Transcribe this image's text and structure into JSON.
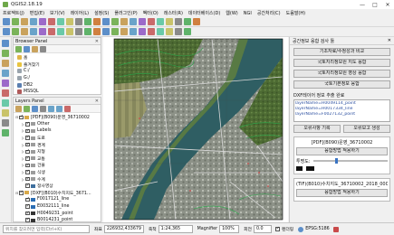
{
  "window": {
    "title": "QGIS2.18.19",
    "controls": [
      "—",
      "□",
      "✕"
    ]
  },
  "menu": [
    "프로젝트(J)",
    "편집(E)",
    "보기(V)",
    "레이어(L)",
    "설정(S)",
    "플러그인(P)",
    "벡터(O)",
    "래스터(R)",
    "데이터베이스(D)",
    "웹(W)",
    "NGI",
    "공간처리(C)",
    "도움말(H)"
  ],
  "browser_panel": {
    "title": "Browser Panel",
    "close": "✕",
    "items": [
      {
        "label": "홈",
        "icon": "home-folder-icon"
      },
      {
        "label": "즐겨찾기",
        "icon": "favorites-star-icon"
      },
      {
        "label": "C:/",
        "icon": "drive-icon"
      },
      {
        "label": "G:/",
        "icon": "drive-icon"
      },
      {
        "label": "DB2",
        "icon": "database-icon"
      },
      {
        "label": "MSSQL",
        "icon": "database-icon"
      }
    ]
  },
  "layers_panel": {
    "title": "Layers Panel",
    "close": "✕",
    "items": [
      {
        "label": "[PDF](B090)운영_36710002",
        "checked": true,
        "expand": "⊟",
        "indent": 0,
        "swatch": "#d8a94a"
      },
      {
        "label": "Other",
        "checked": true,
        "expand": "▷",
        "indent": 1,
        "swatch": "#9c9c9c"
      },
      {
        "label": "Labels",
        "checked": true,
        "expand": "▷",
        "indent": 1,
        "swatch": "#9c9c9c"
      },
      {
        "label": "도로",
        "checked": true,
        "expand": "▷",
        "indent": 1,
        "swatch": "#9c9c9c"
      },
      {
        "label": "경계",
        "checked": true,
        "expand": "▷",
        "indent": 1,
        "swatch": "#9c9c9c"
      },
      {
        "label": "지형",
        "checked": true,
        "expand": "▷",
        "indent": 1,
        "swatch": "#9c9c9c"
      },
      {
        "label": "교통",
        "checked": true,
        "expand": "▷",
        "indent": 1,
        "swatch": "#9c9c9c"
      },
      {
        "label": "건물",
        "checked": true,
        "expand": "▷",
        "indent": 1,
        "swatch": "#9c9c9c"
      },
      {
        "label": "식생",
        "checked": true,
        "expand": "▷",
        "indent": 1,
        "swatch": "#9c9c9c"
      },
      {
        "label": "수계",
        "checked": true,
        "expand": "▷",
        "indent": 1,
        "swatch": "#9c9c9c"
      },
      {
        "label": "정사영상",
        "checked": true,
        "expand": "",
        "indent": 1,
        "swatch": "#3e6f9e"
      },
      {
        "label": "[DXF](B010)수치지도_3671…",
        "checked": true,
        "expand": "⊟",
        "indent": 0,
        "swatch": "#d8a94a"
      },
      {
        "label": "F0017121_line",
        "checked": true,
        "expand": "",
        "indent": 1,
        "swatch": "#2b6db3"
      },
      {
        "label": "E0032111_line",
        "checked": true,
        "expand": "",
        "indent": 1,
        "swatch": "#2b6db3"
      },
      {
        "label": "H0049231_point",
        "checked": true,
        "expand": "",
        "indent": 1,
        "swatch": "#333333"
      },
      {
        "label": "B0014231_point",
        "checked": true,
        "expand": "",
        "indent": 1,
        "swatch": "#333333"
      }
    ]
  },
  "right_panel": {
    "title": "공간정보 융합 검사 툴",
    "close": "✕",
    "buttons": [
      "기초자료/수정성과 비교",
      "국토지리정보원 지도 융합",
      "국토지리정보원 영상 융합",
      "국토기본정보 융합"
    ],
    "dxf_label": "DXF레이어 정보 추출 완료",
    "dxf_layers": [
      "layerName=H0049114_point",
      "layerName=H0017334_line",
      "layerName=F0027132_point"
    ],
    "pair1": [
      "오류사항 기록",
      "오류보고 생성"
    ],
    "pdf_group": {
      "title": "[PDF](B090)운영_36710002",
      "button": "융합방법 적용하기",
      "opacity_label": "투명도:",
      "opacity_percent": 30
    },
    "tif_group": {
      "title": "(TIF)(B010)수치지도_36710002_2018_0000023",
      "button": "융합방법 적용하기"
    }
  },
  "status_bar": {
    "search_placeholder": "위치를 찾으려면 입력(Ctrl+K)",
    "coord_label": "좌표",
    "coord_value": "226932,433679",
    "scale_label": "축척",
    "scale_value": "1:24,365",
    "magnifier_label": "Magnifier",
    "magnifier_value": "100%",
    "rotation_label": "회전",
    "rotation_value": "0.0",
    "render_label": "렌더링",
    "crs_label": "EPSG:5186"
  },
  "colors": {
    "map_river": "#2f5e63",
    "map_vegetation": "#4d6b33",
    "map_urban": "#8a8f86",
    "contour_lines": "#2aa84a",
    "road_lines": "#d6d6d6",
    "label_blue": "#2a4ea0"
  },
  "toolbar_icons_row1": [
    "new-project-icon",
    "open-icon",
    "save-icon",
    "save-as-icon",
    "print-icon",
    "pan-icon",
    "zoom-in-icon",
    "zoom-out-icon",
    "zoom-full-icon",
    "zoom-layer-icon",
    "zoom-prev-icon",
    "zoom-next-icon",
    "refresh-icon",
    "identify-icon",
    "select-icon",
    "deselect-icon",
    "attribute-table-icon",
    "measure-icon",
    "annotation-icon",
    "label-icon",
    "python-icon",
    "plugin-icon"
  ],
  "toolbar_icons_row2": [
    "digitize-icon",
    "edit-pencil-icon",
    "add-feature-icon",
    "move-feature-icon",
    "node-tool-icon",
    "delete-icon",
    "cut-icon",
    "copy-icon",
    "paste-icon",
    "undo-icon",
    "redo-icon",
    "label-pin-icon",
    "label-show-icon",
    "label-move-icon",
    "label-rotate-icon",
    "label-change-icon",
    "raster-calc-icon",
    "georef-icon",
    "merge-icon",
    "clip-icon",
    "buffer-icon"
  ]
}
